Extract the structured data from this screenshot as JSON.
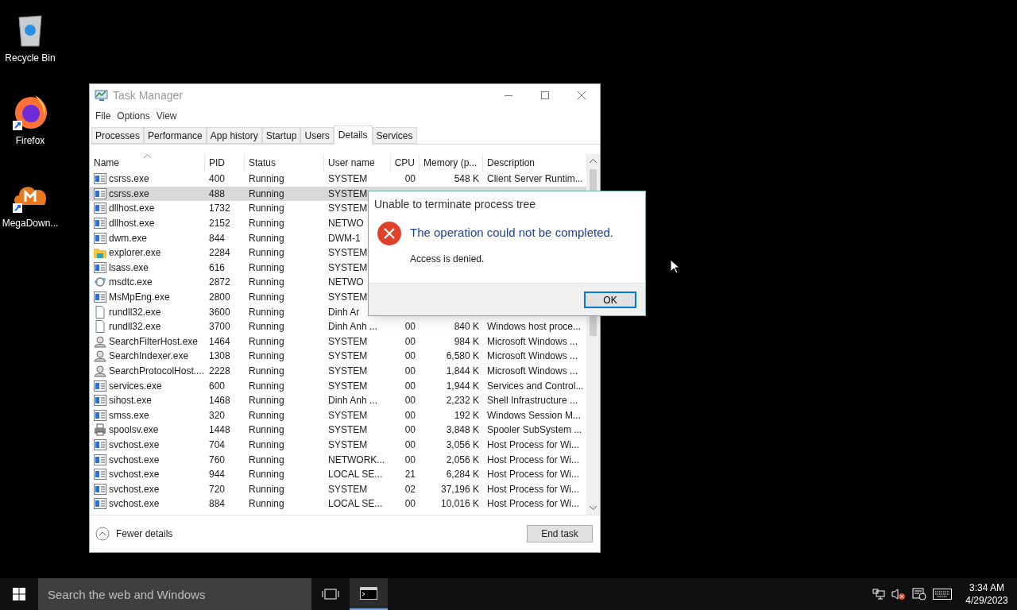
{
  "desktop_icons": [
    {
      "kind": "recycle",
      "label": "Recycle Bin"
    },
    {
      "kind": "firefox",
      "label": "Firefox"
    },
    {
      "kind": "mega",
      "label": "MegaDown..."
    }
  ],
  "window": {
    "title": "Task Manager"
  },
  "menu": [
    "File",
    "Options",
    "View"
  ],
  "tabs": [
    {
      "label": "Processes",
      "selected": false
    },
    {
      "label": "Performance",
      "selected": false
    },
    {
      "label": "App history",
      "selected": false
    },
    {
      "label": "Startup",
      "selected": false
    },
    {
      "label": "Users",
      "selected": false
    },
    {
      "label": "Details",
      "selected": true
    },
    {
      "label": "Services",
      "selected": false
    }
  ],
  "table": {
    "columns": [
      "Name",
      "PID",
      "Status",
      "User name",
      "CPU",
      "Memory (p...",
      "Description"
    ],
    "rows": [
      {
        "kind": "app",
        "selected": false,
        "cells": [
          "csrss.exe",
          "400",
          "Running",
          "SYSTEM",
          "00",
          "548 K",
          "Client Server Runtim..."
        ]
      },
      {
        "kind": "app",
        "selected": true,
        "cells": [
          "csrss.exe",
          "488",
          "Running",
          "SYSTEM"
        ]
      },
      {
        "kind": "app",
        "selected": false,
        "cells": [
          "dllhost.exe",
          "1732",
          "Running",
          "SYSTEM"
        ]
      },
      {
        "kind": "app",
        "selected": false,
        "cells": [
          "dllhost.exe",
          "2152",
          "Running",
          "NETWO"
        ]
      },
      {
        "kind": "app",
        "selected": false,
        "cells": [
          "dwm.exe",
          "844",
          "Running",
          "DWM-1"
        ]
      },
      {
        "kind": "explorer",
        "selected": false,
        "cells": [
          "explorer.exe",
          "2284",
          "Running",
          "SYSTEM"
        ]
      },
      {
        "kind": "app",
        "selected": false,
        "cells": [
          "lsass.exe",
          "616",
          "Running",
          "SYSTEM"
        ]
      },
      {
        "kind": "network",
        "selected": false,
        "cells": [
          "msdtc.exe",
          "2872",
          "Running",
          "NETWO"
        ]
      },
      {
        "kind": "app",
        "selected": false,
        "cells": [
          "MsMpEng.exe",
          "2800",
          "Running",
          "SYSTEM"
        ]
      },
      {
        "kind": "file",
        "selected": false,
        "cells": [
          "rundll32.exe",
          "3600",
          "Running",
          "Dinh  Ar"
        ]
      },
      {
        "kind": "file",
        "selected": false,
        "cells": [
          "rundll32.exe",
          "3700",
          "Running",
          "Dinh  Anh ...",
          "00",
          "840 K",
          "Windows host proce..."
        ]
      },
      {
        "kind": "search",
        "selected": false,
        "cells": [
          "SearchFilterHost.exe",
          "1464",
          "Running",
          "SYSTEM",
          "00",
          "984 K",
          "Microsoft Windows ..."
        ]
      },
      {
        "kind": "search",
        "selected": false,
        "cells": [
          "SearchIndexer.exe",
          "1308",
          "Running",
          "SYSTEM",
          "00",
          "6,580 K",
          "Microsoft Windows ..."
        ]
      },
      {
        "kind": "search",
        "selected": false,
        "cells": [
          "SearchProtocolHost....",
          "2228",
          "Running",
          "SYSTEM",
          "00",
          "1,844 K",
          "Microsoft Windows ..."
        ]
      },
      {
        "kind": "app",
        "selected": false,
        "cells": [
          "services.exe",
          "600",
          "Running",
          "SYSTEM",
          "00",
          "1,944 K",
          "Services and Control..."
        ]
      },
      {
        "kind": "app",
        "selected": false,
        "cells": [
          "sihost.exe",
          "1468",
          "Running",
          "Dinh  Anh ...",
          "00",
          "2,232 K",
          "Shell Infrastructure ..."
        ]
      },
      {
        "kind": "app",
        "selected": false,
        "cells": [
          "smss.exe",
          "320",
          "Running",
          "SYSTEM",
          "00",
          "192 K",
          "Windows Session M..."
        ]
      },
      {
        "kind": "printer",
        "selected": false,
        "cells": [
          "spoolsv.exe",
          "1448",
          "Running",
          "SYSTEM",
          "00",
          "3,848 K",
          "Spooler SubSystem ..."
        ]
      },
      {
        "kind": "app",
        "selected": false,
        "cells": [
          "svchost.exe",
          "704",
          "Running",
          "SYSTEM",
          "00",
          "3,056 K",
          "Host Process for Wi..."
        ]
      },
      {
        "kind": "app",
        "selected": false,
        "cells": [
          "svchost.exe",
          "760",
          "Running",
          "NETWORK...",
          "00",
          "2,056 K",
          "Host Process for Wi..."
        ]
      },
      {
        "kind": "app",
        "selected": false,
        "cells": [
          "svchost.exe",
          "944",
          "Running",
          "LOCAL SE...",
          "21",
          "6,284 K",
          "Host Process for Wi..."
        ]
      },
      {
        "kind": "app",
        "selected": false,
        "cells": [
          "svchost.exe",
          "720",
          "Running",
          "SYSTEM",
          "02",
          "37,196 K",
          "Host Process for Wi..."
        ]
      },
      {
        "kind": "app",
        "selected": false,
        "cells": [
          "svchost.exe",
          "884",
          "Running",
          "LOCAL SE...",
          "00",
          "10,016 K",
          "Host Process for Wi..."
        ]
      }
    ]
  },
  "footer": {
    "toggle": "Fewer details",
    "button": "End task"
  },
  "dialog": {
    "title": "Unable to terminate process tree",
    "heading": "The operation could not be completed.",
    "message": "Access is denied.",
    "button": "OK"
  },
  "taskbar": {
    "search": {
      "placeholder": "Search the web and Windows"
    },
    "time": "3:34 AM",
    "date": "4/29/2023"
  }
}
